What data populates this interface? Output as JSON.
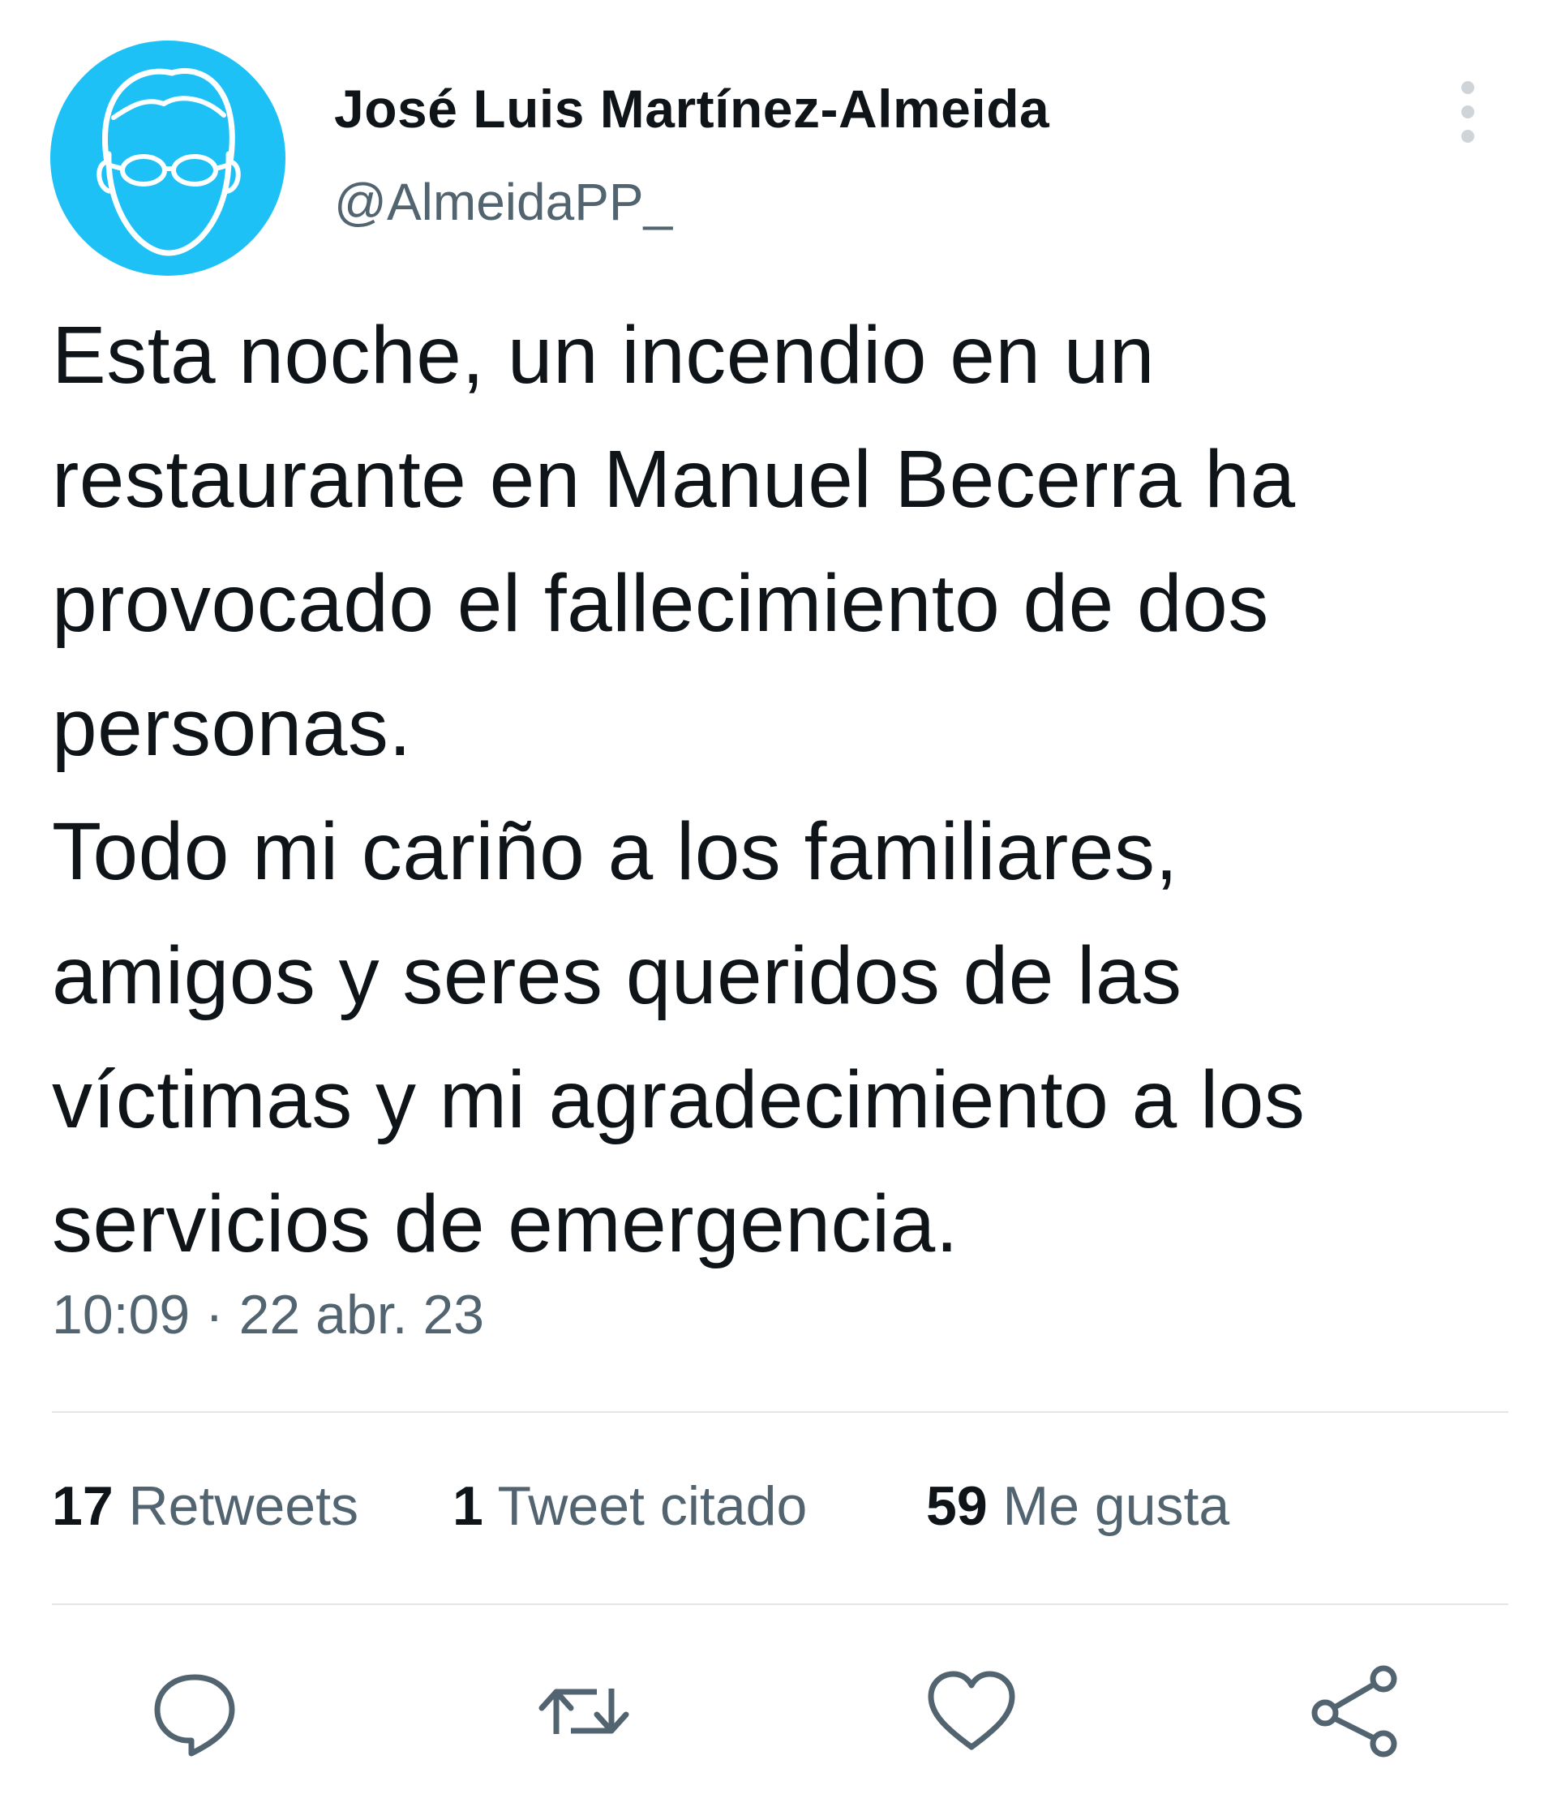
{
  "author": {
    "display_name": "José Luis Martínez-Almeida",
    "handle": "@AlmeidaPP_",
    "avatar_icon": "cartoon-face-with-glasses-icon"
  },
  "menu": {
    "icon": "vertical-ellipsis-icon"
  },
  "tweet": {
    "lines": [
      "Esta noche, un incendio en un",
      "restaurante en Manuel Becerra ha",
      "provocado el fallecimiento de dos",
      "personas.",
      "Todo mi cariño a los familiares,",
      "amigos y seres queridos de las",
      "víctimas y mi agradecimiento a los",
      "servicios de emergencia."
    ],
    "timestamp": "10:09 · 22 abr. 23"
  },
  "stats": {
    "retweets": {
      "count": "17",
      "label": "Retweets"
    },
    "quotes": {
      "count": "1",
      "label": "Tweet citado"
    },
    "likes": {
      "count": "59",
      "label": "Me gusta"
    }
  },
  "actions": {
    "reply_icon": "reply-bubble-icon",
    "retweet_icon": "retweet-icon",
    "like_icon": "heart-icon",
    "share_icon": "share-icon"
  },
  "colors": {
    "avatar_bg": "#1dc1f6",
    "text_primary": "#0f1419",
    "text_secondary": "#536471",
    "icon_gray": "#536471",
    "divider": "#e3e7ea"
  }
}
